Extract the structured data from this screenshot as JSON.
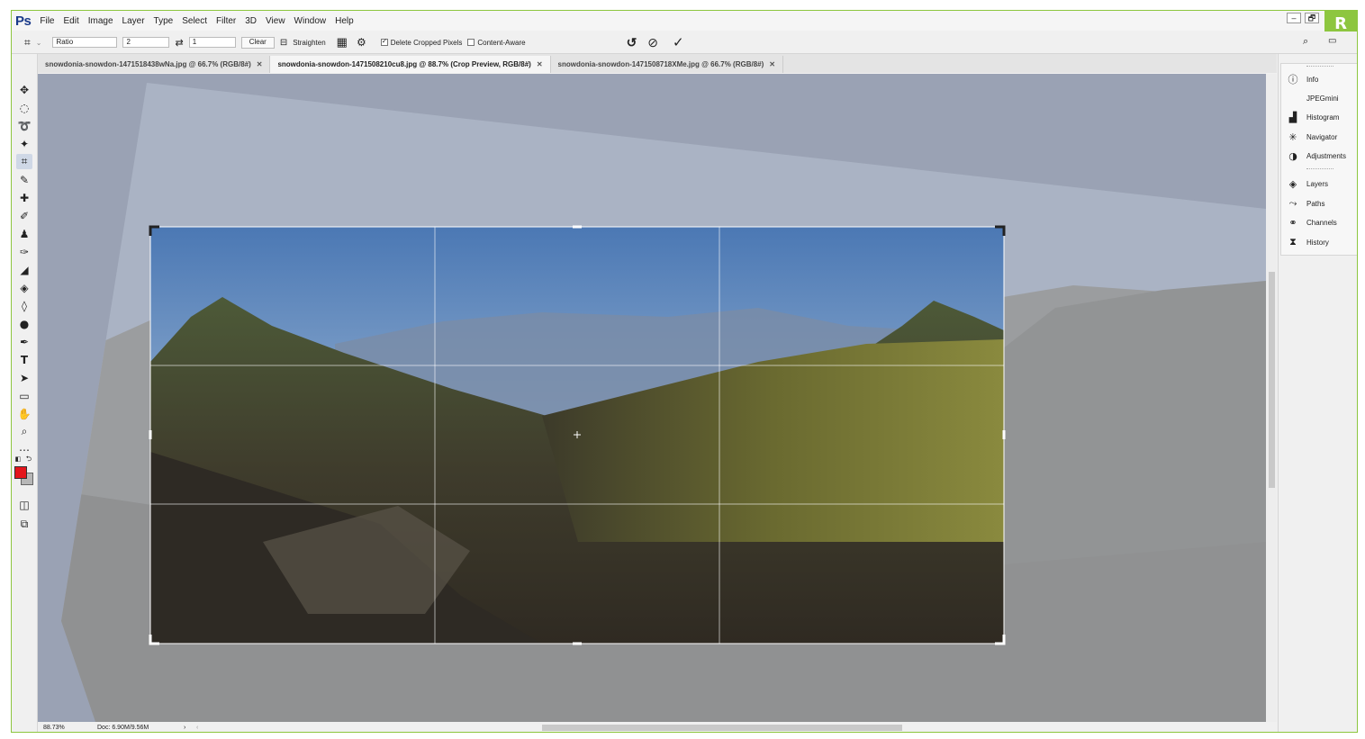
{
  "app": {
    "logo": "Ps",
    "badge": "R"
  },
  "menu": [
    "File",
    "Edit",
    "Image",
    "Layer",
    "Type",
    "Select",
    "Filter",
    "3D",
    "View",
    "Window",
    "Help"
  ],
  "window_controls": {
    "minimize": "–",
    "restore": "🗗"
  },
  "options": {
    "ratio_label": "Ratio",
    "ratio_w": "2",
    "ratio_h": "1",
    "clear_label": "Clear",
    "straighten_label": "Straighten",
    "delete_cropped_label": "Delete Cropped Pixels",
    "delete_cropped_checked": true,
    "content_aware_label": "Content-Aware",
    "content_aware_checked": false
  },
  "tabs": [
    {
      "label": "snowdonia-snowdon-1471518438wNa.jpg @ 66.7% (RGB/8#)",
      "active": false
    },
    {
      "label": "snowdonia-snowdon-1471508210cu8.jpg @ 88.7% (Crop Preview, RGB/8#)",
      "active": true
    },
    {
      "label": "snowdonia-snowdon-1471508718XMe.jpg @ 66.7% (RGB/8#)",
      "active": false
    }
  ],
  "status": {
    "zoom": "88.73%",
    "doc": "Doc: 6.90M/9.56M"
  },
  "panels": {
    "group1": [
      {
        "label": "Info",
        "icon": "info-icon",
        "glyph": "ⓘ"
      },
      {
        "label": "JPEGmini",
        "icon": "",
        "glyph": ""
      },
      {
        "label": "Histogram",
        "icon": "histogram-icon",
        "glyph": "▟"
      },
      {
        "label": "Navigator",
        "icon": "navigator-icon",
        "glyph": "✳"
      },
      {
        "label": "Adjustments",
        "icon": "adjustments-icon",
        "glyph": "◑"
      }
    ],
    "group2": [
      {
        "label": "Layers",
        "icon": "layers-icon",
        "glyph": "◈"
      },
      {
        "label": "Paths",
        "icon": "paths-icon",
        "glyph": "⤳"
      },
      {
        "label": "Channels",
        "icon": "channels-icon",
        "glyph": "⚭"
      },
      {
        "label": "History",
        "icon": "history-icon",
        "glyph": "⧗"
      }
    ]
  },
  "colors": {
    "accent": "#8dc63f",
    "foreground": "#e3161c",
    "background": "#b7b7b7"
  }
}
